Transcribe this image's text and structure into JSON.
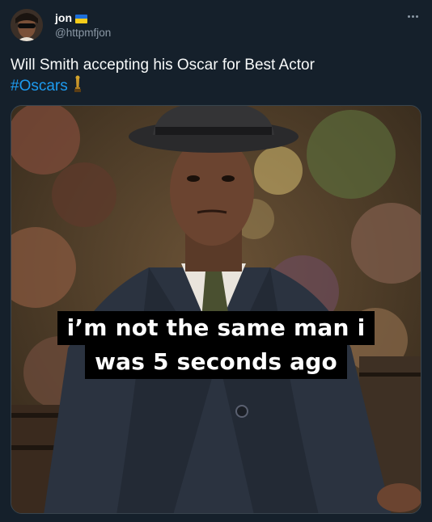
{
  "user": {
    "display_name": "jon",
    "flag_icon": "ukraine-flag-icon",
    "handle": "@httpmfjon",
    "avatar_icon": "profile-avatar"
  },
  "tweet": {
    "text": "Will Smith accepting his Oscar for Best Actor",
    "hashtag": "#Oscars",
    "emoji_icon": "oscar-trophy-icon"
  },
  "media": {
    "caption_line1": "i’m not the same man i",
    "caption_line2": "was 5 seconds ago"
  },
  "colors": {
    "background": "#15202b",
    "link": "#1d9bf0",
    "secondary_text": "#8b98a5"
  },
  "menu": {
    "more_icon": "more-options-icon"
  }
}
